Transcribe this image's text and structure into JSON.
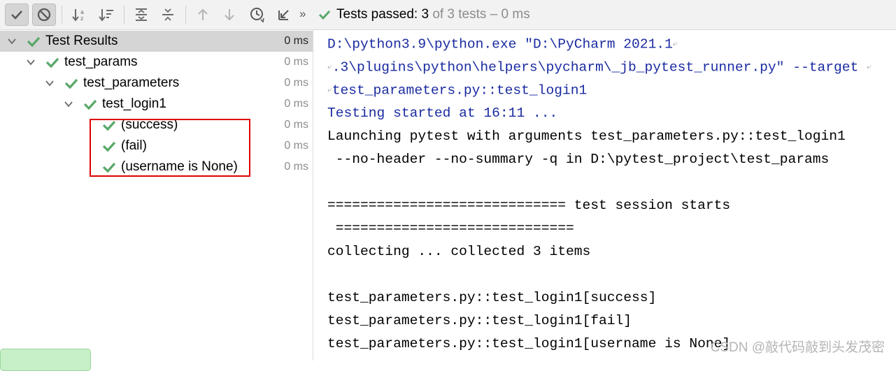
{
  "toolbar": {
    "buttons": [
      {
        "name": "show-passed-icon"
      },
      {
        "name": "show-ignored-icon"
      },
      {
        "name": "sort-alphabetically-icon"
      },
      {
        "name": "sort-by-duration-icon"
      },
      {
        "name": "expand-all-icon"
      },
      {
        "name": "collapse-all-icon"
      },
      {
        "name": "previous-failed-icon"
      },
      {
        "name": "next-failed-icon"
      },
      {
        "name": "test-history-icon"
      },
      {
        "name": "import-tests-icon"
      }
    ],
    "overflow": "»"
  },
  "status": {
    "prefix": "Tests passed:",
    "passed": "3",
    "suffix": "of 3 tests – 0 ms"
  },
  "tree": [
    {
      "label": "Test Results",
      "time": "0 ms"
    },
    {
      "label": "test_params",
      "time": "0 ms"
    },
    {
      "label": "test_parameters",
      "time": "0 ms"
    },
    {
      "label": "test_login1",
      "time": "0 ms"
    },
    {
      "label": "(success)",
      "time": "0 ms"
    },
    {
      "label": "(fail)",
      "time": "0 ms"
    },
    {
      "label": "(username is None)",
      "time": "0 ms"
    }
  ],
  "console": {
    "lines": [
      "D:\\python3.9\\python.exe \"D:\\PyCharm 2021.1",
      ".3\\plugins\\python\\helpers\\pycharm\\_jb_pytest_runner.py\" --target",
      "test_parameters.py::test_login1",
      "Testing started at 16:11 ...",
      "Launching pytest with arguments test_parameters.py::test_login1",
      " --no-header --no-summary -q in D:\\pytest_project\\test_params",
      "",
      "============================= test session starts",
      " =============================",
      "collecting ... collected 3 items",
      "",
      "test_parameters.py::test_login1[success]",
      "test_parameters.py::test_login1[fail]",
      "test_parameters.py::test_login1[username is None]"
    ],
    "wrap_mark": "⤶"
  },
  "watermark": "CSDN @敲代码敲到头发茂密",
  "colors": {
    "pass_green": "#59a869",
    "command_blue": "#1a2ba0",
    "highlight_red": "#e00000"
  }
}
